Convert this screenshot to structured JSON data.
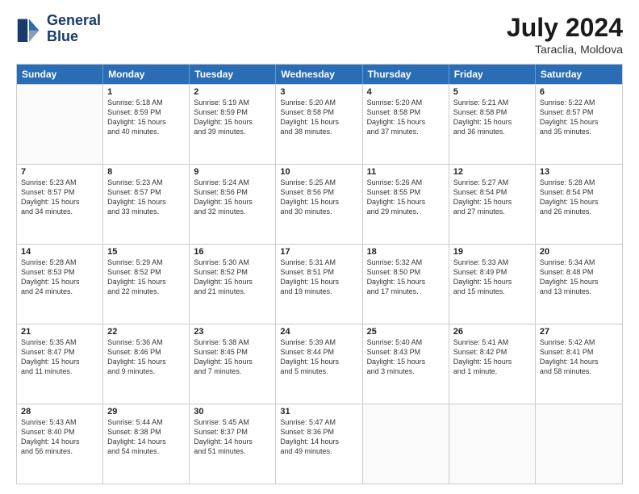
{
  "header": {
    "logo_line1": "General",
    "logo_line2": "Blue",
    "main_title": "July 2024",
    "subtitle": "Taraclia, Moldova"
  },
  "calendar": {
    "days_of_week": [
      "Sunday",
      "Monday",
      "Tuesday",
      "Wednesday",
      "Thursday",
      "Friday",
      "Saturday"
    ],
    "rows": [
      [
        {
          "day": "",
          "info": ""
        },
        {
          "day": "1",
          "info": "Sunrise: 5:18 AM\nSunset: 8:59 PM\nDaylight: 15 hours\nand 40 minutes."
        },
        {
          "day": "2",
          "info": "Sunrise: 5:19 AM\nSunset: 8:59 PM\nDaylight: 15 hours\nand 39 minutes."
        },
        {
          "day": "3",
          "info": "Sunrise: 5:20 AM\nSunset: 8:58 PM\nDaylight: 15 hours\nand 38 minutes."
        },
        {
          "day": "4",
          "info": "Sunrise: 5:20 AM\nSunset: 8:58 PM\nDaylight: 15 hours\nand 37 minutes."
        },
        {
          "day": "5",
          "info": "Sunrise: 5:21 AM\nSunset: 8:58 PM\nDaylight: 15 hours\nand 36 minutes."
        },
        {
          "day": "6",
          "info": "Sunrise: 5:22 AM\nSunset: 8:57 PM\nDaylight: 15 hours\nand 35 minutes."
        }
      ],
      [
        {
          "day": "7",
          "info": "Sunrise: 5:23 AM\nSunset: 8:57 PM\nDaylight: 15 hours\nand 34 minutes."
        },
        {
          "day": "8",
          "info": "Sunrise: 5:23 AM\nSunset: 8:57 PM\nDaylight: 15 hours\nand 33 minutes."
        },
        {
          "day": "9",
          "info": "Sunrise: 5:24 AM\nSunset: 8:56 PM\nDaylight: 15 hours\nand 32 minutes."
        },
        {
          "day": "10",
          "info": "Sunrise: 5:25 AM\nSunset: 8:56 PM\nDaylight: 15 hours\nand 30 minutes."
        },
        {
          "day": "11",
          "info": "Sunrise: 5:26 AM\nSunset: 8:55 PM\nDaylight: 15 hours\nand 29 minutes."
        },
        {
          "day": "12",
          "info": "Sunrise: 5:27 AM\nSunset: 8:54 PM\nDaylight: 15 hours\nand 27 minutes."
        },
        {
          "day": "13",
          "info": "Sunrise: 5:28 AM\nSunset: 8:54 PM\nDaylight: 15 hours\nand 26 minutes."
        }
      ],
      [
        {
          "day": "14",
          "info": "Sunrise: 5:28 AM\nSunset: 8:53 PM\nDaylight: 15 hours\nand 24 minutes."
        },
        {
          "day": "15",
          "info": "Sunrise: 5:29 AM\nSunset: 8:52 PM\nDaylight: 15 hours\nand 22 minutes."
        },
        {
          "day": "16",
          "info": "Sunrise: 5:30 AM\nSunset: 8:52 PM\nDaylight: 15 hours\nand 21 minutes."
        },
        {
          "day": "17",
          "info": "Sunrise: 5:31 AM\nSunset: 8:51 PM\nDaylight: 15 hours\nand 19 minutes."
        },
        {
          "day": "18",
          "info": "Sunrise: 5:32 AM\nSunset: 8:50 PM\nDaylight: 15 hours\nand 17 minutes."
        },
        {
          "day": "19",
          "info": "Sunrise: 5:33 AM\nSunset: 8:49 PM\nDaylight: 15 hours\nand 15 minutes."
        },
        {
          "day": "20",
          "info": "Sunrise: 5:34 AM\nSunset: 8:48 PM\nDaylight: 15 hours\nand 13 minutes."
        }
      ],
      [
        {
          "day": "21",
          "info": "Sunrise: 5:35 AM\nSunset: 8:47 PM\nDaylight: 15 hours\nand 11 minutes."
        },
        {
          "day": "22",
          "info": "Sunrise: 5:36 AM\nSunset: 8:46 PM\nDaylight: 15 hours\nand 9 minutes."
        },
        {
          "day": "23",
          "info": "Sunrise: 5:38 AM\nSunset: 8:45 PM\nDaylight: 15 hours\nand 7 minutes."
        },
        {
          "day": "24",
          "info": "Sunrise: 5:39 AM\nSunset: 8:44 PM\nDaylight: 15 hours\nand 5 minutes."
        },
        {
          "day": "25",
          "info": "Sunrise: 5:40 AM\nSunset: 8:43 PM\nDaylight: 15 hours\nand 3 minutes."
        },
        {
          "day": "26",
          "info": "Sunrise: 5:41 AM\nSunset: 8:42 PM\nDaylight: 15 hours\nand 1 minute."
        },
        {
          "day": "27",
          "info": "Sunrise: 5:42 AM\nSunset: 8:41 PM\nDaylight: 14 hours\nand 58 minutes."
        }
      ],
      [
        {
          "day": "28",
          "info": "Sunrise: 5:43 AM\nSunset: 8:40 PM\nDaylight: 14 hours\nand 56 minutes."
        },
        {
          "day": "29",
          "info": "Sunrise: 5:44 AM\nSunset: 8:38 PM\nDaylight: 14 hours\nand 54 minutes."
        },
        {
          "day": "30",
          "info": "Sunrise: 5:45 AM\nSunset: 8:37 PM\nDaylight: 14 hours\nand 51 minutes."
        },
        {
          "day": "31",
          "info": "Sunrise: 5:47 AM\nSunset: 8:36 PM\nDaylight: 14 hours\nand 49 minutes."
        },
        {
          "day": "",
          "info": ""
        },
        {
          "day": "",
          "info": ""
        },
        {
          "day": "",
          "info": ""
        }
      ]
    ]
  }
}
